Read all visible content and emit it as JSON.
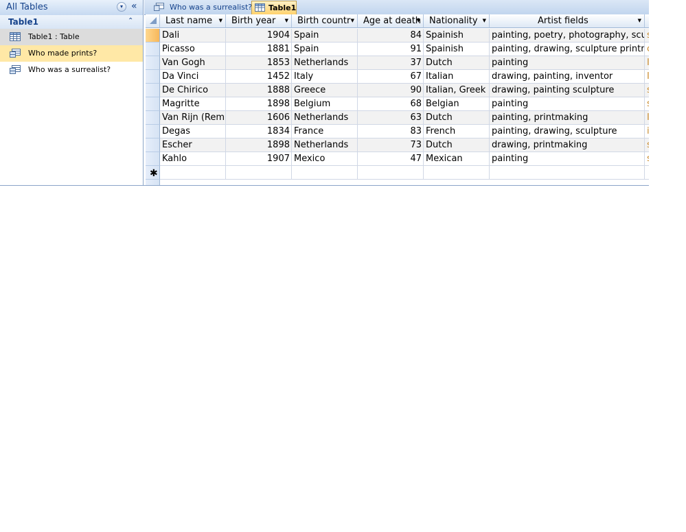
{
  "nav": {
    "title": "All Tables",
    "dropdown_glyph": "▾",
    "collapse_glyph": "«",
    "group_title": "Table1",
    "group_chevron": "⌃",
    "items": [
      {
        "label": "Table1 : Table",
        "icon": "table-icon"
      },
      {
        "label": "Who made prints?",
        "icon": "query-icon"
      },
      {
        "label": "Who was a surrealist?",
        "icon": "query-icon"
      }
    ]
  },
  "tabs": [
    {
      "label": "Who was a surrealist?",
      "icon": "query-icon",
      "active": false
    },
    {
      "label": "Table1",
      "icon": "table-icon",
      "active": true
    }
  ],
  "datasheet": {
    "columns": [
      {
        "label": "Last name",
        "has_filter": true
      },
      {
        "label": "Birth year",
        "has_filter": true
      },
      {
        "label": "Birth countr",
        "has_filter": true
      },
      {
        "label": "Age at death",
        "has_filter": true
      },
      {
        "label": "Nationality",
        "has_filter": true
      },
      {
        "label": "Artist fields",
        "has_filter": true
      },
      {
        "label": "",
        "has_filter": false
      }
    ],
    "rows": [
      [
        "Dali",
        "1904",
        "Spain",
        "84",
        "Spainish",
        "painting, poetry, photography, sculpture",
        "s"
      ],
      [
        "Picasso",
        "1881",
        "Spain",
        "91",
        "Spainish",
        "painting, drawing, sculpture printmaking",
        "c"
      ],
      [
        "Van Gogh",
        "1853",
        "Netherlands",
        "37",
        "Dutch",
        "painting",
        "I"
      ],
      [
        "Da Vinci",
        "1452",
        "Italy",
        "67",
        "Italian",
        "drawing, painting, inventor",
        "I"
      ],
      [
        "De Chirico",
        "1888",
        "Greece",
        "90",
        "Italian, Greek",
        "drawing, painting sculpture",
        "s"
      ],
      [
        "Magritte",
        "1898",
        "Belgium",
        "68",
        "Belgian",
        "painting",
        "s"
      ],
      [
        "Van Rijn (Rembrandt)",
        "1606",
        "Netherlands",
        "63",
        "Dutch",
        "painting, printmaking",
        "I"
      ],
      [
        "Degas",
        "1834",
        "France",
        "83",
        "French",
        "painting, drawing, sculpture",
        "i"
      ],
      [
        "Escher",
        "1898",
        "Netherlands",
        "73",
        "Dutch",
        "drawing, printmaking",
        "s"
      ],
      [
        "Kahlo",
        "1907",
        "Mexico",
        "47",
        "Mexican",
        "painting",
        "s"
      ]
    ],
    "new_record_glyph": "✱",
    "filter_glyph": "▼"
  },
  "colors": {
    "accent": "#15428b",
    "selected_row": "#ffe8a6",
    "active_tab": "#ffd26e"
  }
}
